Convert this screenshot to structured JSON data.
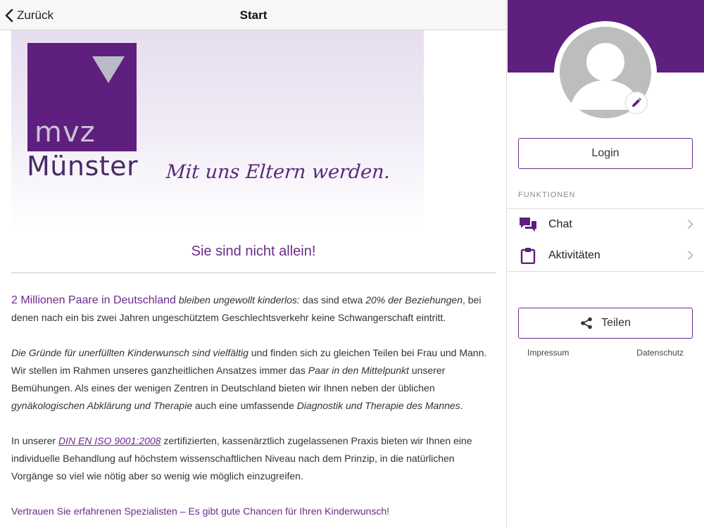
{
  "navbar": {
    "back_label": "Zurück",
    "title": "Start"
  },
  "banner": {
    "logo_mvz": "mvz",
    "logo_city": "Münster",
    "slogan": "Mit uns Eltern werden."
  },
  "main": {
    "headline": "Sie sind nicht allein!",
    "p1": {
      "lead": "2 Millionen Paare in Deutschland",
      "italic1": "bleiben ungewollt kinderlos:",
      "text1": " das sind etwa ",
      "italic2": "20% der Beziehungen",
      "text2": ", bei denen nach ein bis zwei Jahren ungeschütztem Geschlechtsverkehr keine Schwangerschaft eintritt."
    },
    "p2": {
      "italic1": "Die Gründe für unerfüllten Kinderwunsch sind vielfältig",
      "text1": " und finden sich zu gleichen Teilen bei Frau und Mann. Wir stellen im Rahmen unseres ganzheitlichen Ansatzes immer das ",
      "italic2": "Paar in den Mittelpunkt",
      "text2": " unserer Bemühungen. Als eines der wenigen Zentren in Deutschland bieten wir Ihnen neben der üblichen ",
      "italic3": "gynäkologischen Abklärung und Therapie",
      "text3": " auch eine umfassende ",
      "italic4": "Diagnostik und Therapie des Mannes",
      "text4": "."
    },
    "p3": {
      "text1": "In unserer ",
      "link": "DIN EN ISO 9001:2008",
      "text2": " zertifizierten, kassenärztlich zugelassenen Praxis bieten wir Ihnen eine individuelle Behandlung auf höchstem wissenschaftlichen Niveau nach dem Prinzip, in die natürlichen Vorgänge so viel wie nötig aber so wenig wie möglich einzugreifen."
    },
    "p4": "Vertrauen Sie erfahrenen Spezialisten – Es gibt gute Chancen für Ihren Kinderwunsch!"
  },
  "side": {
    "login_label": "Login",
    "section_label": "FUNKTIONEN",
    "menu": [
      {
        "label": "Chat",
        "icon": "chat-icon"
      },
      {
        "label": "Aktivitäten",
        "icon": "clipboard-icon"
      }
    ],
    "share_label": "Teilen",
    "footer": {
      "impressum": "Impressum",
      "datenschutz": "Datenschutz"
    }
  },
  "colors": {
    "brand_purple": "#5e1f7e",
    "accent_purple": "#6b2c8c"
  }
}
